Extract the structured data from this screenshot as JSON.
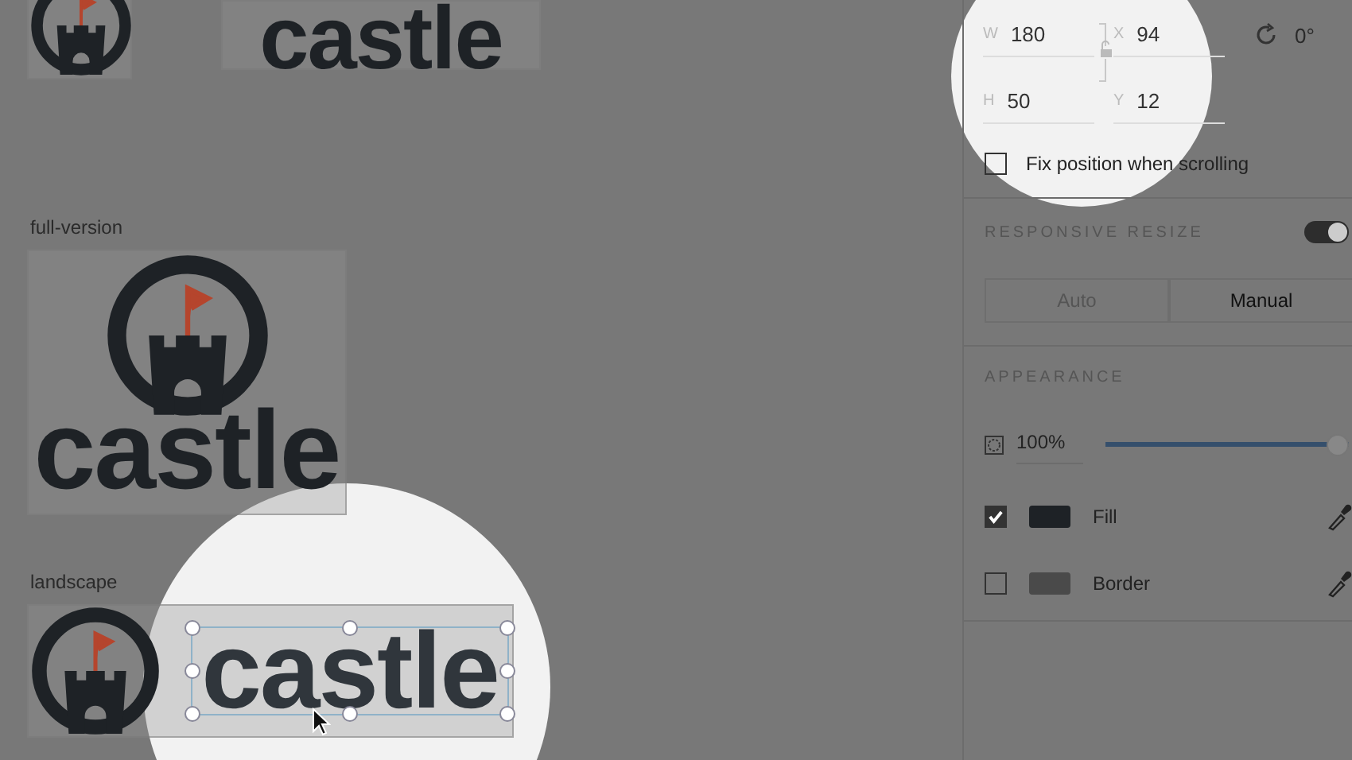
{
  "canvas": {
    "top_wordmark": {
      "text": "castle"
    },
    "full_version": {
      "label": "full-version",
      "wordmark": "castle"
    },
    "landscape": {
      "label": "landscape",
      "wordmark": "castle",
      "selected": true
    }
  },
  "panel": {
    "transform": {
      "fields": [
        {
          "label": "W",
          "value": "180"
        },
        {
          "label": "X",
          "value": "94"
        },
        {
          "label": "H",
          "value": "50"
        },
        {
          "label": "Y",
          "value": "12"
        }
      ],
      "rotation": "0°"
    },
    "fix_position": {
      "label": "Fix position when scrolling",
      "checked": false
    },
    "responsive_resize": {
      "title": "RESPONSIVE RESIZE",
      "on": true,
      "options": [
        {
          "label": "Auto",
          "selected": false
        },
        {
          "label": "Manual",
          "selected": true
        }
      ]
    },
    "appearance": {
      "title": "APPEARANCE",
      "opacity": {
        "reading": "100%",
        "level": 1
      },
      "items": [
        {
          "label": "Fill",
          "checked": true,
          "color": "#1e2226"
        },
        {
          "label": "Border",
          "checked": false,
          "color": "#4a4a4a"
        }
      ]
    }
  }
}
